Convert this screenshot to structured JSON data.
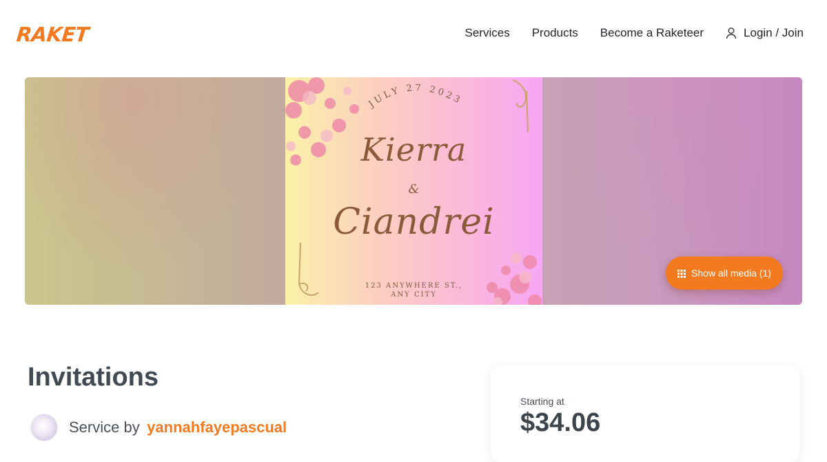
{
  "header": {
    "logo": "RAKET",
    "nav": {
      "services": "Services",
      "products": "Products",
      "become": "Become a Raketeer",
      "login": "Login / Join"
    }
  },
  "hero": {
    "card": {
      "date": "JULY 27 2023",
      "name1": "Kierra",
      "amp": "&",
      "name2": "Ciandrei",
      "address_line1": "123 ANYWHERE ST.,",
      "address_line2": "ANY CITY"
    },
    "show_media_label": "Show all media (1)"
  },
  "listing": {
    "title": "Invitations",
    "service_by_label": "Service by",
    "username": "yannahfayepascual"
  },
  "pricing": {
    "starting_label": "Starting at",
    "price": "$34.06"
  },
  "colors": {
    "brand": "#f47a20",
    "text": "#414a52"
  },
  "icons": [
    "user-icon",
    "grid-icon"
  ]
}
